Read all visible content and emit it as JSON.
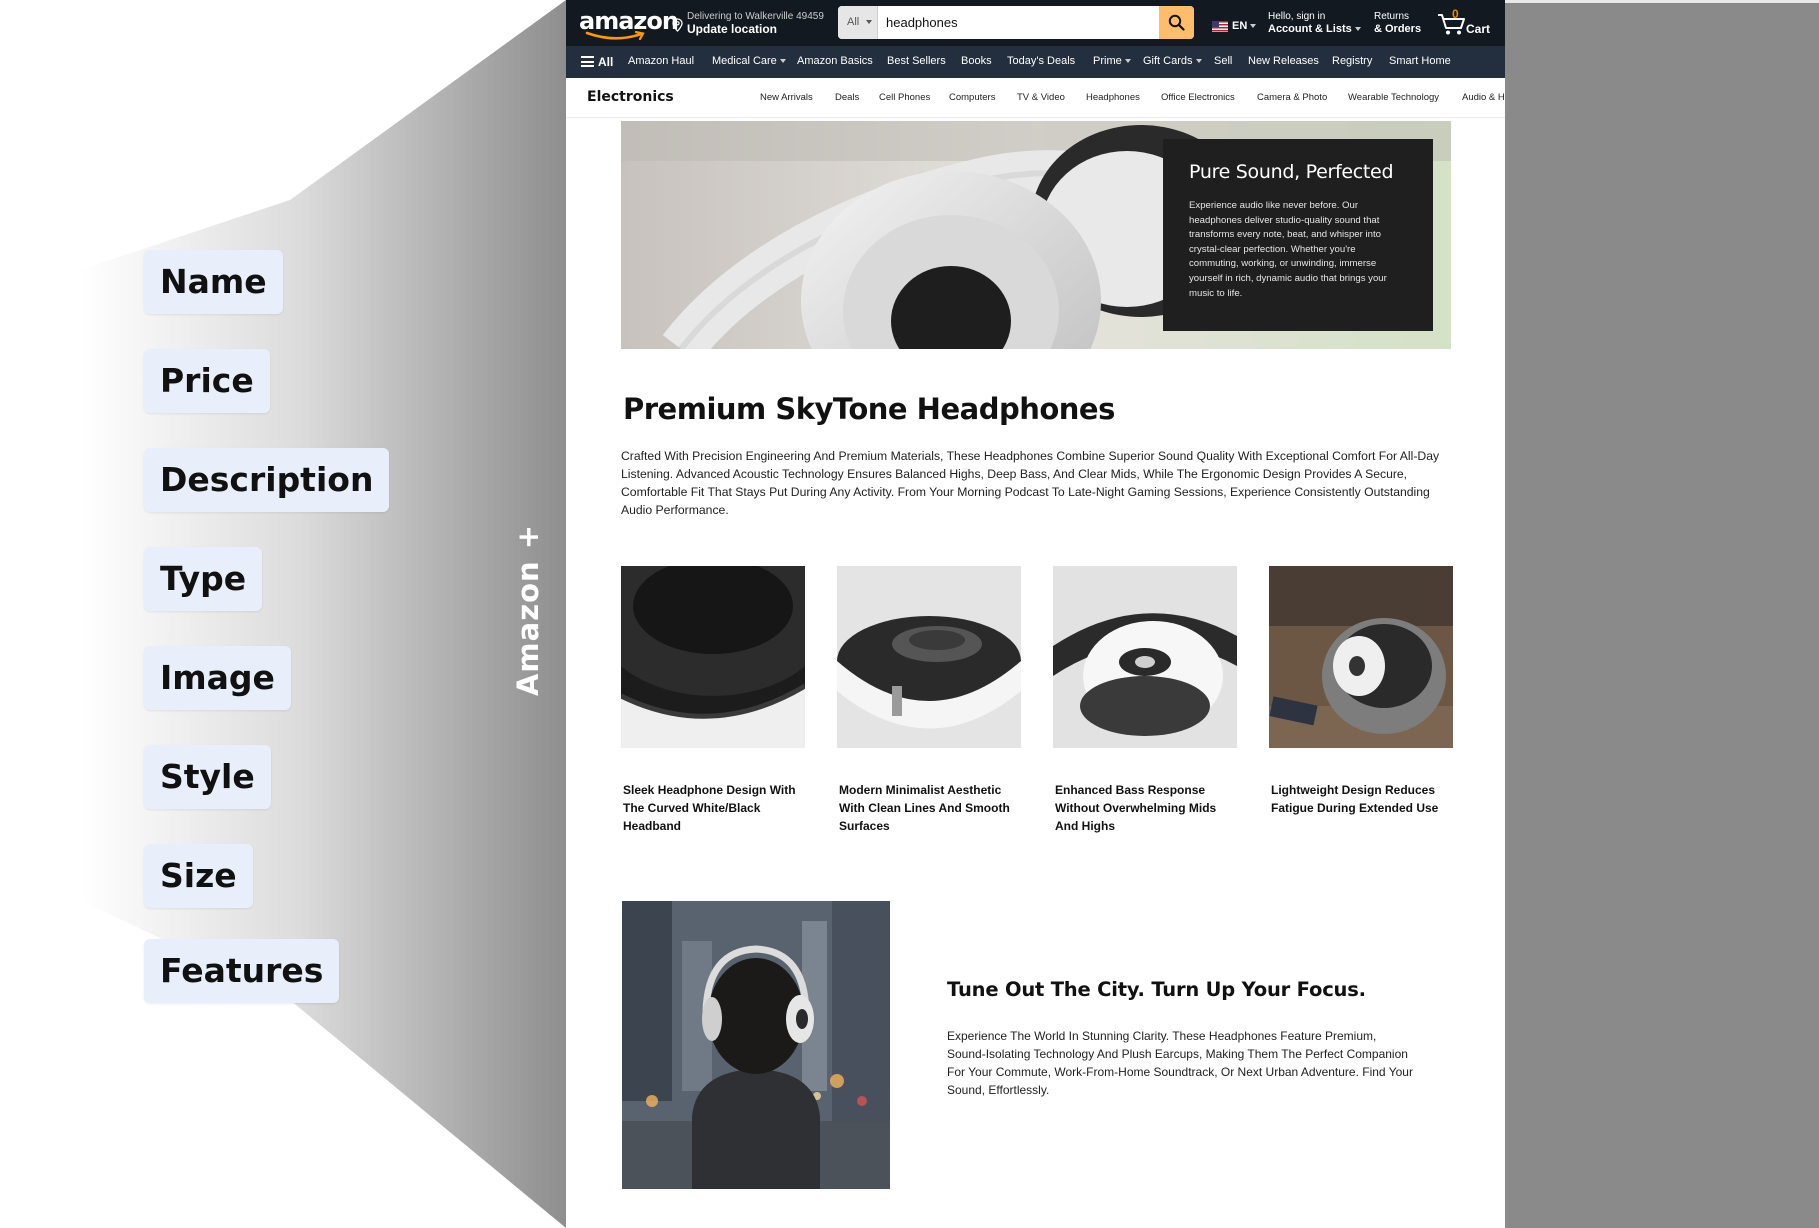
{
  "annotation": {
    "fields": [
      "Name",
      "Price",
      "Description",
      "Type",
      "Image",
      "Style",
      "Size",
      "Features"
    ],
    "side_label": "Amazon +"
  },
  "header": {
    "logo": "amazon",
    "location_line1": "Delivering to Walkerville 49459",
    "location_line2": "Update location",
    "search_category": "All",
    "search_value": "headphones",
    "language": "EN",
    "account_line1": "Hello, sign in",
    "account_line2": "Account & Lists",
    "returns_line1": "Returns",
    "returns_line2": "& Orders",
    "cart_count": "0",
    "cart_label": "Cart"
  },
  "subnav": {
    "all_label": "All",
    "items": [
      "Amazon Haul",
      "Medical Care",
      "Amazon Basics",
      "Best Sellers",
      "Books",
      "Today's Deals",
      "Prime",
      "Gift Cards",
      "Sell",
      "New Releases",
      "Registry",
      "Smart Home"
    ]
  },
  "category_bar": {
    "title": "Electronics",
    "links": [
      "New Arrivals",
      "Deals",
      "Cell Phones",
      "Computers",
      "TV & Video",
      "Headphones",
      "Office Electronics",
      "Camera & Photo",
      "Wearable Technology",
      "Audio & H"
    ]
  },
  "hero": {
    "title": "Pure Sound, Perfected",
    "text": "Experience audio like never before. Our headphones deliver studio-quality sound that transforms every note, beat, and whisper into crystal-clear perfection. Whether you're commuting, working, or unwinding, immerse yourself in rich, dynamic audio that brings your music to life."
  },
  "product": {
    "title": "Premium SkyTone Headphones",
    "description": "Crafted With Precision Engineering And Premium Materials, These Headphones Combine Superior Sound Quality With Exceptional Comfort For All-Day Listening. Advanced Acoustic Technology Ensures Balanced Highs, Deep Bass, And Clear Mids, While The Ergonomic Design Provides A Secure, Comfortable Fit That Stays Put During Any Activity. From Your Morning Podcast To Late-Night Gaming Sessions, Experience Consistently Outstanding Audio Performance."
  },
  "gallery": [
    {
      "caption": "Sleek Headphone Design With The Curved White/Black Headband"
    },
    {
      "caption": "Modern Minimalist Aesthetic With Clean Lines And Smooth Surfaces"
    },
    {
      "caption": "Enhanced Bass Response Without Overwhelming Mids And Highs"
    },
    {
      "caption": "Lightweight Design Reduces Fatigue During Extended Use"
    }
  ],
  "lifestyle": {
    "title": "Tune Out The City. Turn Up Your Focus.",
    "text": "Experience The World In Stunning Clarity. These Headphones Feature Premium, Sound-Isolating Technology And Plush Earcups, Making Them The Perfect Companion For Your Commute, Work-From-Home Soundtrack, Or Next Urban Adventure. Find Your Sound, Effortlessly."
  },
  "colors": {
    "nav_dark": "#131921",
    "nav_secondary": "#232f3e",
    "search_button": "#febd69",
    "cart_count": "#f08804",
    "chip_bg": "#e9eefb",
    "side_gray": "#8a8a8a"
  }
}
